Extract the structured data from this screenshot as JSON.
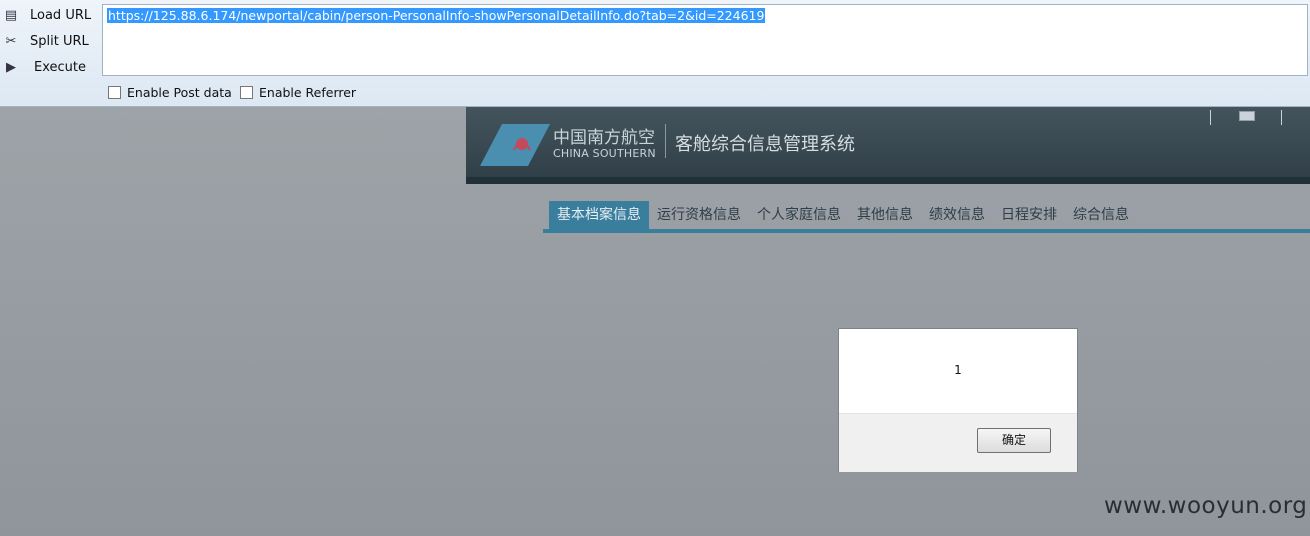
{
  "toolbar": {
    "load_url": "Load URL",
    "split_url": "Split URL",
    "execute": "Execute",
    "url": "https://125.88.6.174/newportal/cabin/person-PersonalInfo-showPersonalDetailInfo.do?tab=2&id=224619",
    "enable_post": "Enable Post data",
    "enable_referrer": "Enable Referrer"
  },
  "header": {
    "brand_cn": "中国南方航空",
    "brand_en": "CHINA SOUTHERN",
    "system_title": "客舱综合信息管理系统"
  },
  "nav": {
    "tabs": [
      "基本档案信息",
      "运行资格信息",
      "个人家庭信息",
      "其他信息",
      "绩效信息",
      "日程安排",
      "综合信息"
    ],
    "active_index": 0
  },
  "dialog": {
    "message": "1",
    "ok_label": "确定"
  },
  "watermark": "www.wooyun.org",
  "colors": {
    "accent": "#3a7e9e",
    "selection": "#3399ff",
    "header_bg": "#3a4a53"
  }
}
